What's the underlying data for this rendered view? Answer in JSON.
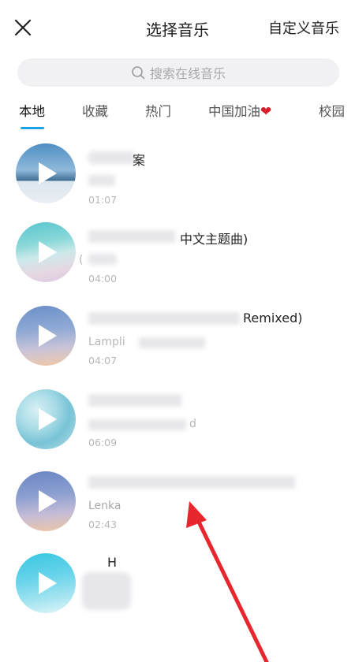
{
  "header": {
    "close_icon": "close-icon",
    "title": "选择音乐",
    "custom_music": "自定义音乐"
  },
  "search": {
    "icon": "search-icon",
    "placeholder": "搜索在线音乐"
  },
  "tabs": [
    {
      "label": "本地",
      "active": true
    },
    {
      "label": "收藏",
      "active": false
    },
    {
      "label": "热门",
      "active": false
    },
    {
      "label": "中国加油",
      "active": false,
      "emoji": "❤"
    },
    {
      "label": "校园",
      "active": false
    }
  ],
  "songs": [
    {
      "name": "案",
      "artist": "",
      "duration": "01:07"
    },
    {
      "name": "中文主题曲)",
      "artist": "(",
      "duration": "04:00"
    },
    {
      "name": "Remixed)",
      "artist": "Lampli",
      "duration": "04:07"
    },
    {
      "name": "",
      "artist": "d",
      "duration": "06:09"
    },
    {
      "name": "",
      "artist": "Lenka",
      "duration": "02:43"
    },
    {
      "name": "H",
      "artist": "",
      "duration": ""
    }
  ],
  "colors": {
    "accent": "#1aa3e8",
    "arrow": "#e8262e",
    "heart": "#d81e2c"
  }
}
